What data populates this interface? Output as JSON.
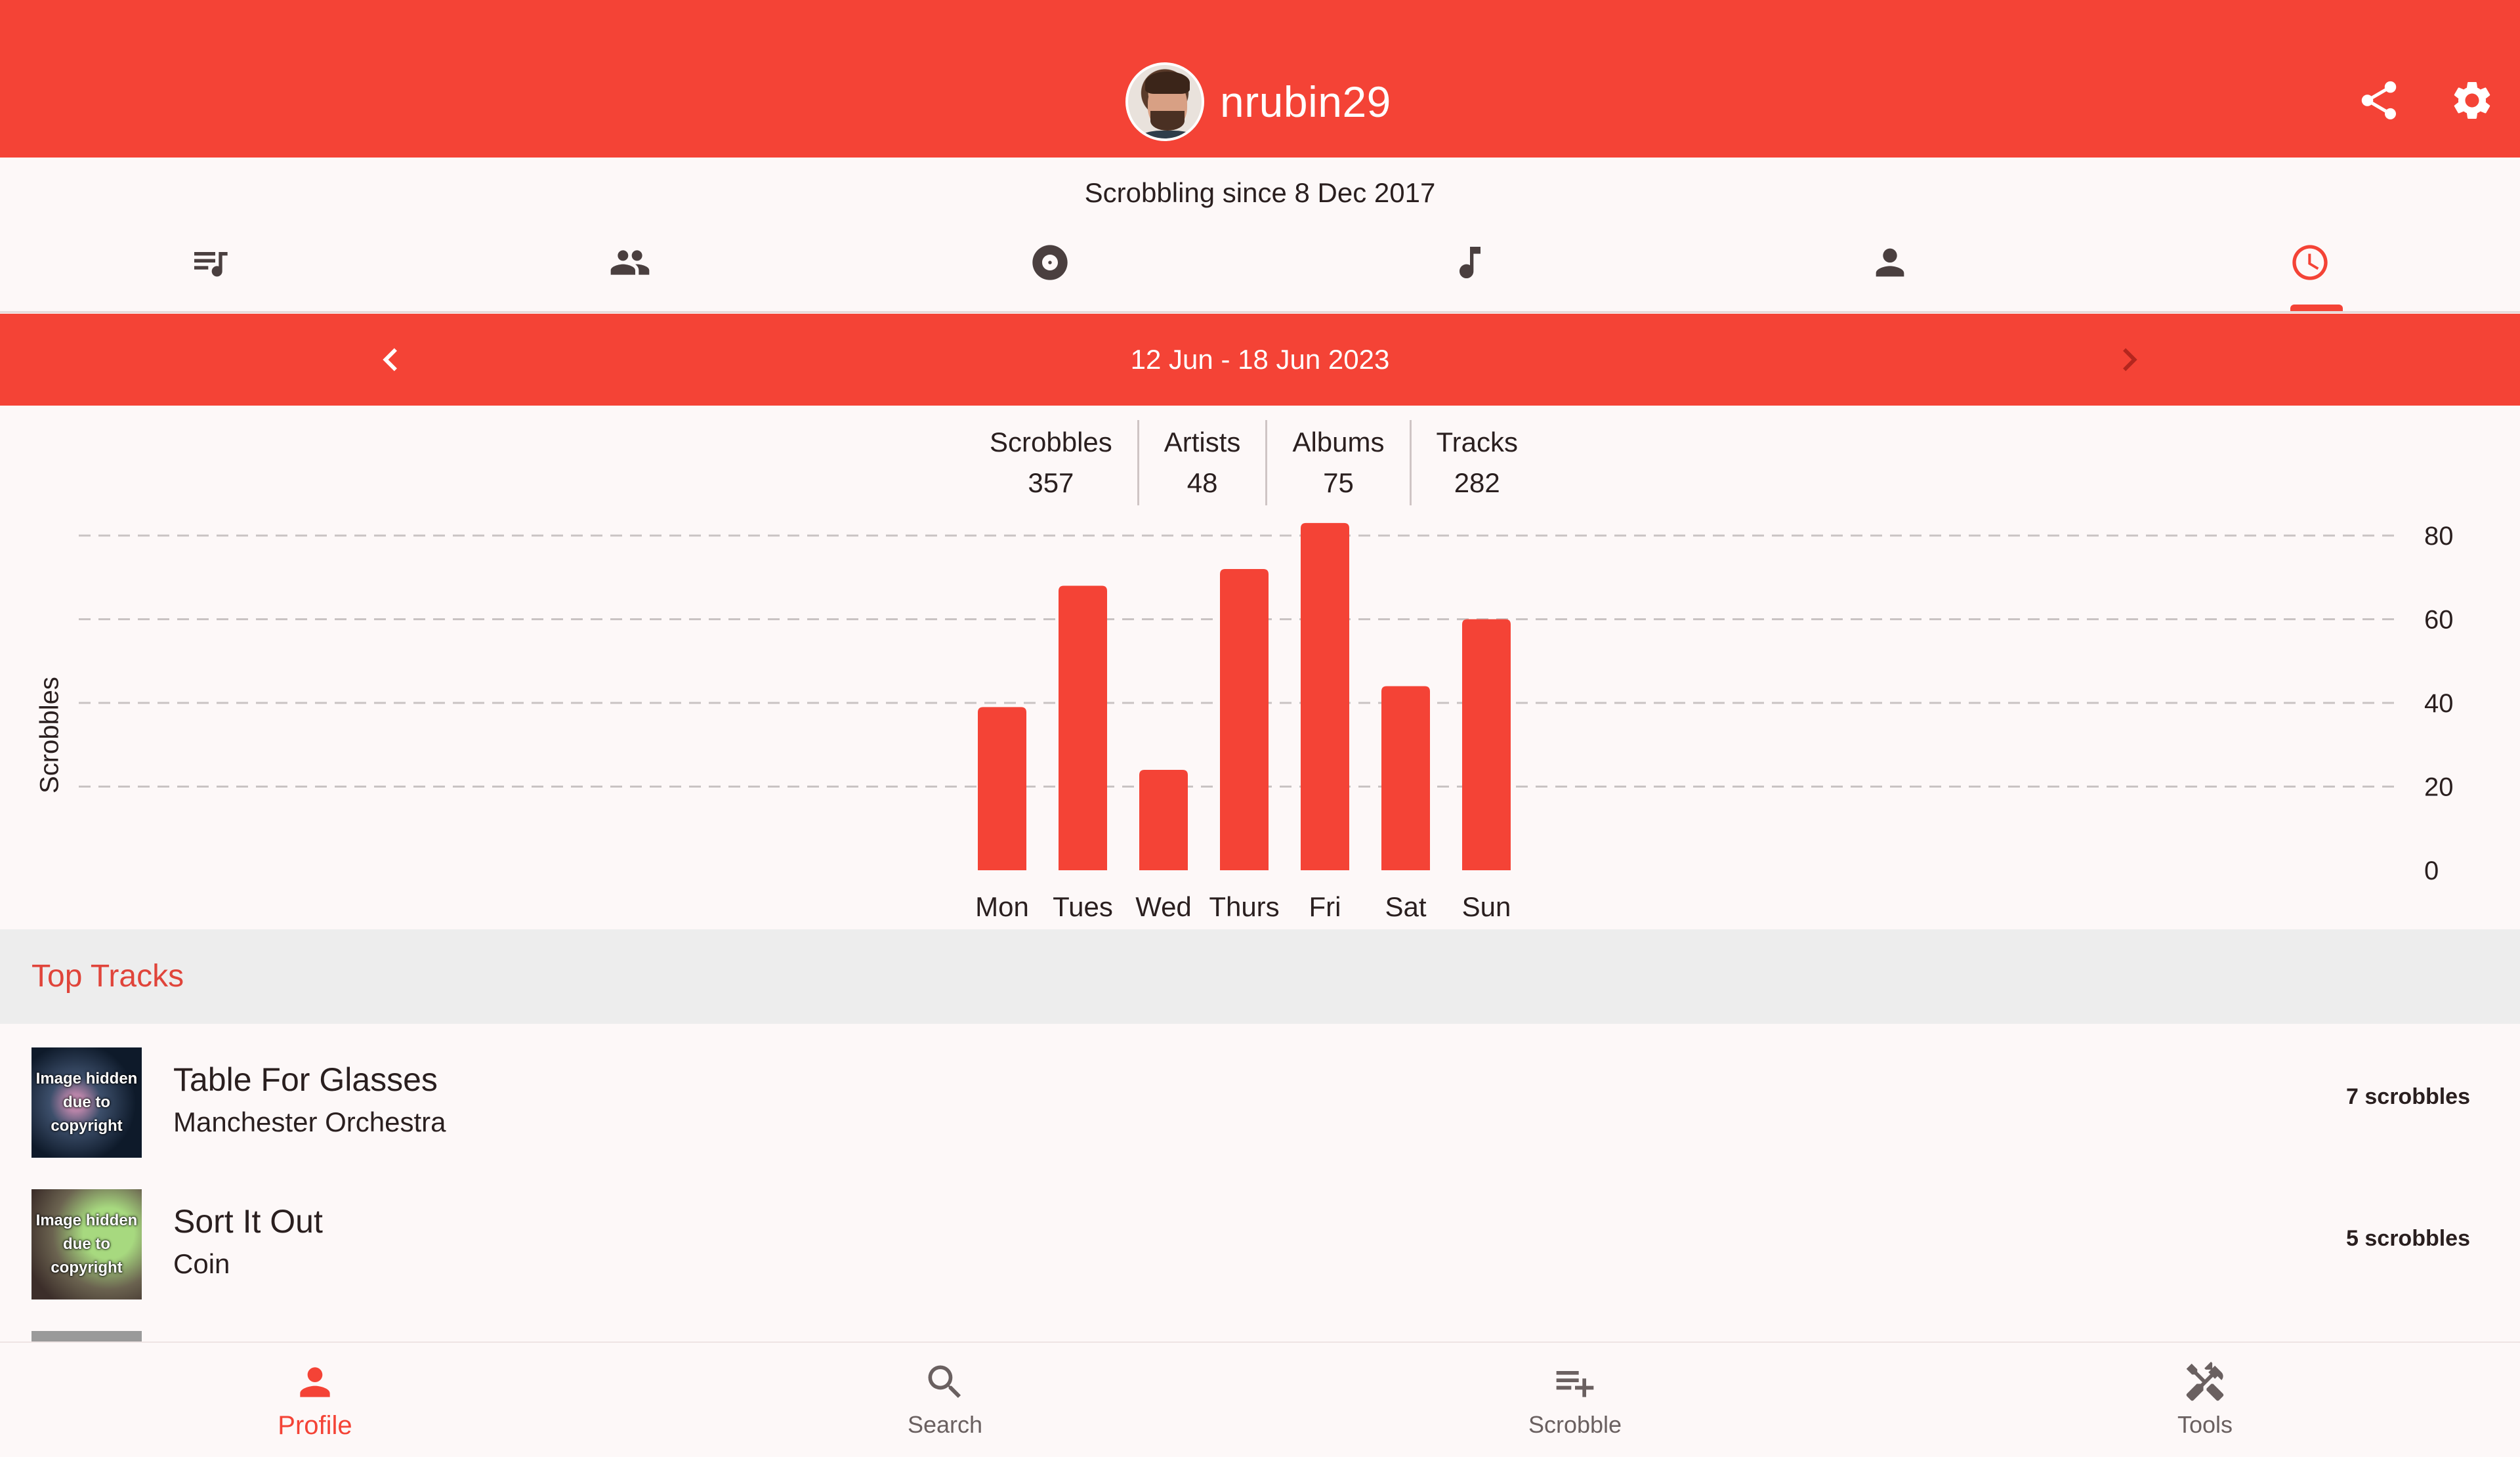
{
  "header": {
    "username": "nrubin29",
    "since": "Scrobbling since 8 Dec 2017"
  },
  "icons": {
    "share": "share-icon",
    "settings": "gear-icon"
  },
  "tabs": [
    {
      "icon": "playlist-icon",
      "active": false
    },
    {
      "icon": "people-icon",
      "active": false
    },
    {
      "icon": "album-disc-icon",
      "active": false
    },
    {
      "icon": "music-note-icon",
      "active": false
    },
    {
      "icon": "person-icon",
      "active": false
    },
    {
      "icon": "clock-icon",
      "active": true
    }
  ],
  "week": {
    "range": "12 Jun - 18 Jun 2023"
  },
  "stats": [
    {
      "label": "Scrobbles",
      "value": "357"
    },
    {
      "label": "Artists",
      "value": "48"
    },
    {
      "label": "Albums",
      "value": "75"
    },
    {
      "label": "Tracks",
      "value": "282"
    }
  ],
  "chart_data": {
    "type": "bar",
    "categories": [
      "Mon",
      "Tues",
      "Wed",
      "Thurs",
      "Fri",
      "Sat",
      "Sun"
    ],
    "values": [
      39,
      68,
      24,
      72,
      83,
      44,
      60
    ],
    "ylabel": "Scrobbles",
    "xlabel": "",
    "yticks": [
      0,
      20,
      40,
      60,
      80
    ],
    "ylim": [
      0,
      80
    ],
    "grid": true,
    "color": "#f44336"
  },
  "top_tracks": {
    "title": "Top Tracks",
    "art_placeholder": "Image hidden due to copyright",
    "items": [
      {
        "name": "Table For Glasses",
        "artist": "Manchester Orchestra",
        "count": "7 scrobbles"
      },
      {
        "name": "Sort It Out",
        "artist": "Coin",
        "count": "5 scrobbles"
      }
    ]
  },
  "bottom_nav": [
    {
      "label": "Profile",
      "icon": "person-icon",
      "active": true
    },
    {
      "label": "Search",
      "icon": "search-icon",
      "active": false
    },
    {
      "label": "Scrobble",
      "icon": "playlist-add-icon",
      "active": false
    },
    {
      "label": "Tools",
      "icon": "tools-icon",
      "active": false
    }
  ],
  "colors": {
    "accent": "#f44336",
    "background": "#fdf8f8",
    "section_bg": "#ededed"
  }
}
